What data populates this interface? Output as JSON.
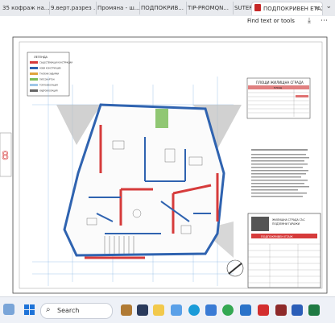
{
  "browser": {
    "tabs": [
      {
        "label": "35 кофраж на...",
        "active": false
      },
      {
        "label": "9.верт.разрез ...",
        "active": false
      },
      {
        "label": "Промяна - ш...",
        "active": false
      },
      {
        "label": "ПОДПОКРИВ...",
        "active": false
      },
      {
        "label": "TIP-PROMQN...",
        "active": false
      },
      {
        "label": "SUTEREN.pdf",
        "active": false
      },
      {
        "label": "ПОДПОКРИВЕН ЕТАЖ -...",
        "active": true
      }
    ],
    "find_label": "Find text or tools"
  },
  "drawing": {
    "legend_header": "ЛЕГЕНДА",
    "legend_items": [
      {
        "text": "СЪЩЕСТВУВАЩИ КОНСТРУКЦИИ",
        "color": "#d63b3b"
      },
      {
        "text": "НОВИ КОНСТРУКЦИИ",
        "color": "#2f63b0"
      },
      {
        "text": "ТУХЛЕНИ ЗИДАРИИ",
        "color": "#e0a43c"
      },
      {
        "text": "ГИПСОКАРТОН",
        "color": "#7dbd5a"
      },
      {
        "text": "ТОПЛОИЗОЛАЦИЯ",
        "color": "#9fc7e8"
      },
      {
        "text": "ХИДРОИЗОЛАЦИЯ",
        "color": "#666666"
      }
    ],
    "area_table_title": "ПЛОЩИ ЖИЛИЩНА СГРАДА",
    "area_table_header": "ПЛОЩ",
    "title_block_lines": [
      "ЖИЛИЩНА СГРАДА СЪС",
      "ПОДЗЕМНИ ГАРАЖИ",
      "ПОДПОКРИВЕН ЕТАЖ"
    ],
    "sheet_marker": "8",
    "accent_red": "#d63b3b",
    "accent_blue": "#2f63b0"
  },
  "taskbar": {
    "search_label": "Search",
    "search_icon": "search-icon",
    "apps": [
      "start-icon",
      "search-icon",
      "file-explorer-icon",
      "edge-icon",
      "chrome-icon",
      "mail-icon",
      "acrobat-icon",
      "word-icon",
      "excel-icon",
      "store-icon"
    ]
  }
}
